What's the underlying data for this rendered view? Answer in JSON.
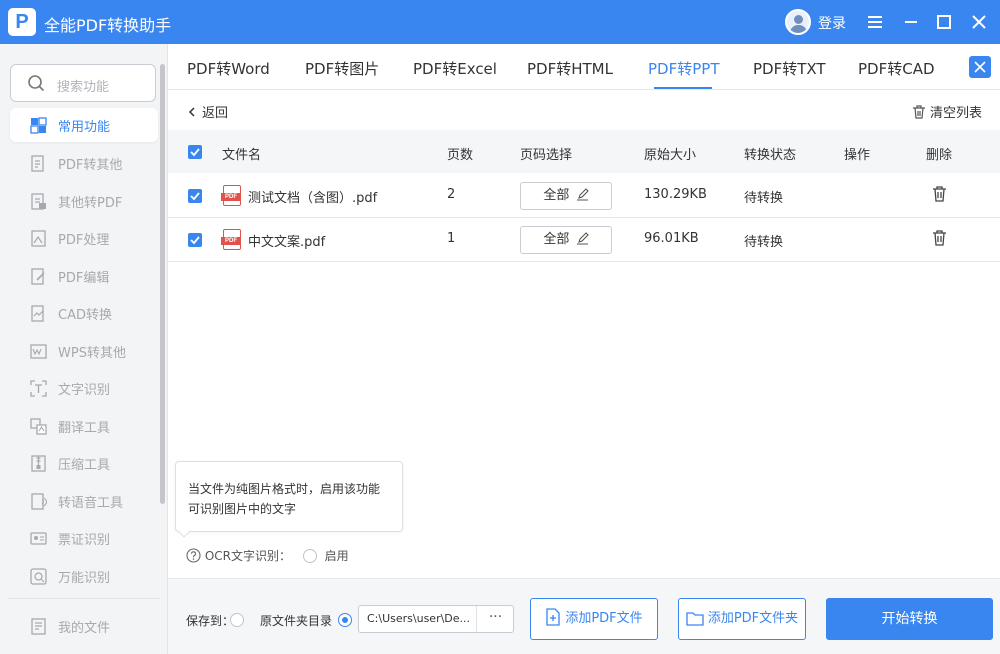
{
  "app": {
    "title": "全能PDF转换助手",
    "logo_letter": "P",
    "login_label": "登录"
  },
  "sidebar": {
    "search_placeholder": "搜索功能",
    "items": [
      {
        "label": "常用功能",
        "icon": "common-functions-icon",
        "active": true
      },
      {
        "label": "PDF转其他",
        "icon": "pdf-to-other-icon"
      },
      {
        "label": "其他转PDF",
        "icon": "other-to-pdf-icon"
      },
      {
        "label": "PDF处理",
        "icon": "pdf-process-icon"
      },
      {
        "label": "PDF编辑",
        "icon": "pdf-edit-icon"
      },
      {
        "label": "CAD转换",
        "icon": "cad-convert-icon"
      },
      {
        "label": "WPS转其他",
        "icon": "wps-convert-icon"
      },
      {
        "label": "文字识别",
        "icon": "text-recognition-icon"
      },
      {
        "label": "翻译工具",
        "icon": "translate-icon"
      },
      {
        "label": "压缩工具",
        "icon": "compress-icon"
      },
      {
        "label": "转语音工具",
        "icon": "voice-icon"
      },
      {
        "label": "票证识别",
        "icon": "ticket-recognition-icon"
      },
      {
        "label": "万能识别",
        "icon": "universal-recognition-icon"
      }
    ],
    "my_files": "我的文件"
  },
  "tabs": [
    {
      "label": "PDF转Word"
    },
    {
      "label": "PDF转图片"
    },
    {
      "label": "PDF转Excel"
    },
    {
      "label": "PDF转HTML"
    },
    {
      "label": "PDF转PPT",
      "active": true
    },
    {
      "label": "PDF转TXT"
    },
    {
      "label": "PDF转CAD"
    }
  ],
  "toolbar": {
    "back": "返回",
    "clear_list": "清空列表"
  },
  "table": {
    "headers": {
      "filename": "文件名",
      "pages": "页数",
      "page_select": "页码选择",
      "original_size": "原始大小",
      "status": "转换状态",
      "action": "操作",
      "delete": "删除"
    },
    "rows": [
      {
        "filename": "测试文档（含图）.pdf",
        "pages": "2",
        "page_select": "全部",
        "size": "130.29KB",
        "status": "待转换"
      },
      {
        "filename": "中文文案.pdf",
        "pages": "1",
        "page_select": "全部",
        "size": "96.01KB",
        "status": "待转换"
      }
    ]
  },
  "pdf_badge": "PDF",
  "ocr": {
    "tooltip": "当文件为纯图片格式时，启用该功能可识别图片中的文字",
    "label": "OCR文字识别：",
    "enable": "启用"
  },
  "bottom": {
    "save_to": "保存到：",
    "original_dir": "原文件夹目录",
    "path": "C:\\Users\\user\\De...",
    "browse": "···",
    "add_file": "添加PDF文件",
    "add_folder": "添加PDF文件夹",
    "start": "开始转换"
  },
  "colors": {
    "accent": "#3a86f0",
    "pdf_red": "#e2524a"
  }
}
